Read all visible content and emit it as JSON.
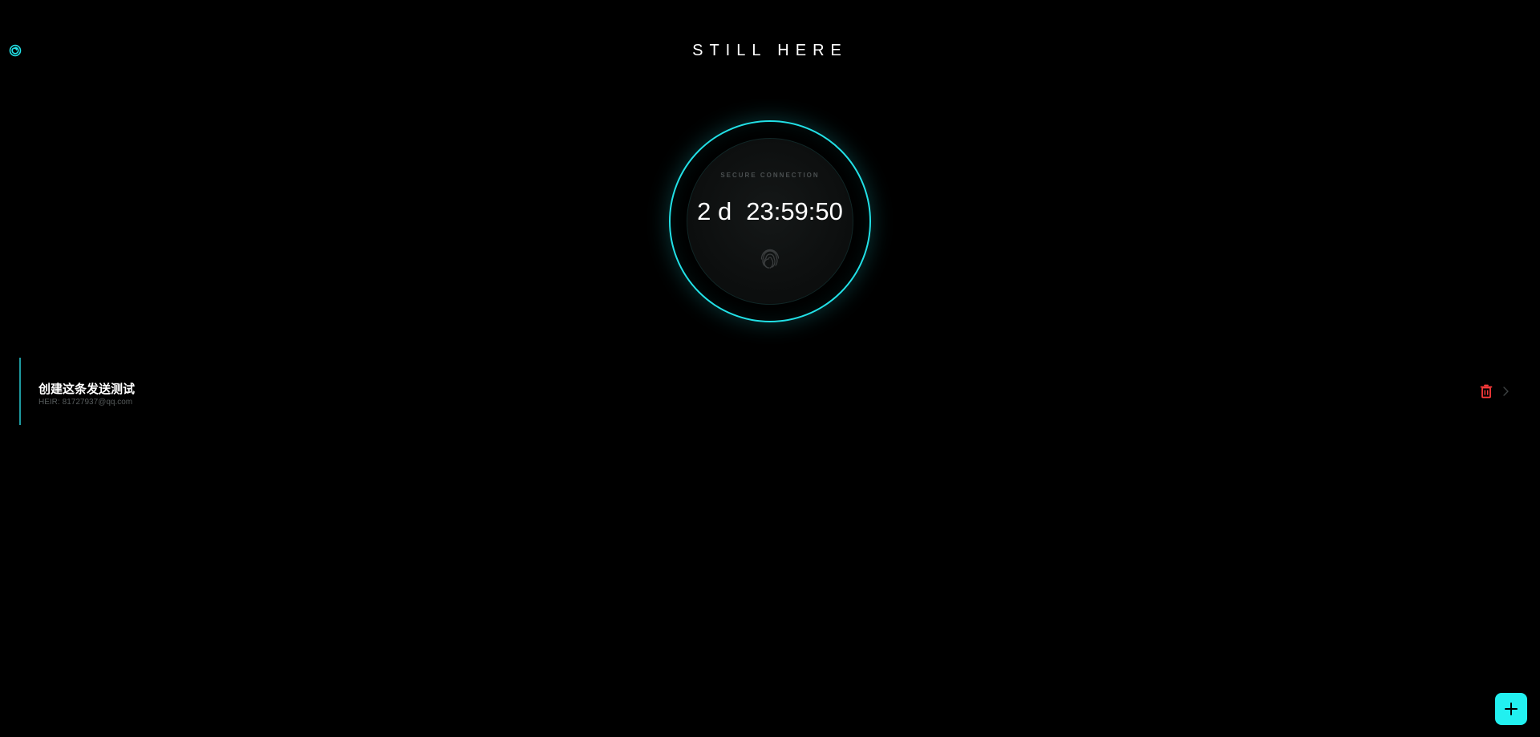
{
  "header": {
    "title": "STILL HERE",
    "logo_icon": "spiral-icon"
  },
  "status": {
    "label": "SECURE CONNECTION",
    "days": "2 d",
    "time": "23:59:50",
    "fingerprint_icon": "fingerprint-icon"
  },
  "items": [
    {
      "title": "创建这条发送测试",
      "heir_label": "HEIR:",
      "heir_email": "81727937@qq.com"
    }
  ],
  "actions": {
    "delete_icon": "trash-icon",
    "open_icon": "chevron-right-icon",
    "add_icon": "plus-icon"
  },
  "colors": {
    "accent": "#22e0e6",
    "danger": "#ff3b3b",
    "background": "#000000"
  }
}
